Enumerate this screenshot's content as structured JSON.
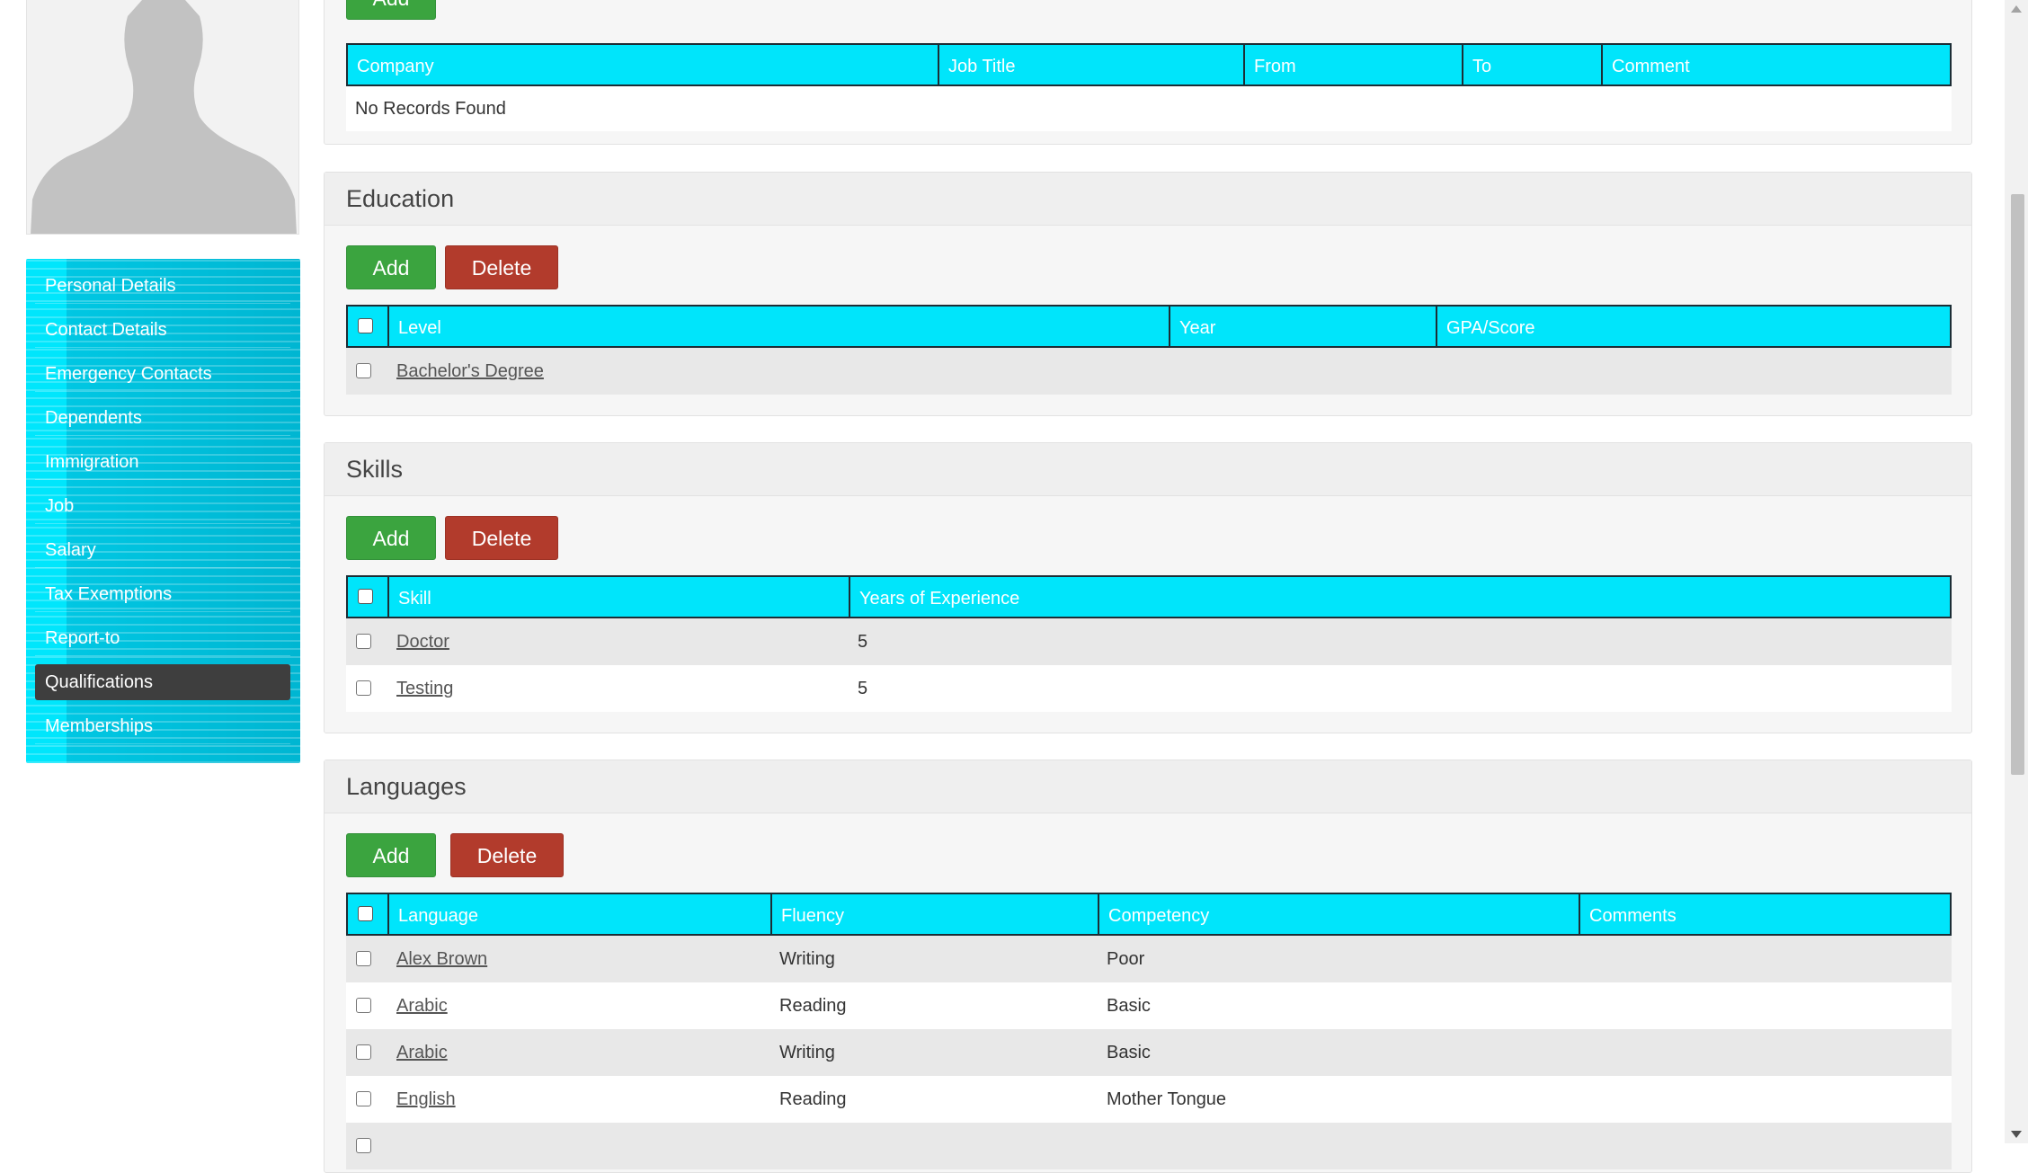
{
  "sidebar": {
    "items": [
      {
        "label": "Personal Details"
      },
      {
        "label": "Contact Details"
      },
      {
        "label": "Emergency Contacts"
      },
      {
        "label": "Dependents"
      },
      {
        "label": "Immigration"
      },
      {
        "label": "Job"
      },
      {
        "label": "Salary"
      },
      {
        "label": "Tax Exemptions"
      },
      {
        "label": "Report-to"
      },
      {
        "label": "Qualifications"
      },
      {
        "label": "Memberships"
      }
    ],
    "active": "Qualifications"
  },
  "work_experience": {
    "add_label": "Add",
    "columns": [
      "Company",
      "Job Title",
      "From",
      "To",
      "Comment"
    ],
    "empty_text": "No Records Found"
  },
  "education": {
    "title": "Education",
    "add_label": "Add",
    "delete_label": "Delete",
    "columns": [
      "Level",
      "Year",
      "GPA/Score"
    ],
    "rows": [
      {
        "level": "Bachelor's Degree",
        "year": "",
        "score": ""
      }
    ]
  },
  "skills": {
    "title": "Skills",
    "add_label": "Add",
    "delete_label": "Delete",
    "columns": [
      "Skill",
      "Years of Experience"
    ],
    "rows": [
      {
        "skill": "Doctor",
        "years": "5"
      },
      {
        "skill": "Testing",
        "years": "5"
      }
    ]
  },
  "languages": {
    "title": "Languages",
    "add_label": "Add",
    "delete_label": "Delete",
    "columns": [
      "Language",
      "Fluency",
      "Competency",
      "Comments"
    ],
    "rows": [
      {
        "language": "Alex Brown",
        "fluency": "Writing",
        "competency": "Poor",
        "comments": ""
      },
      {
        "language": "Arabic",
        "fluency": "Reading",
        "competency": "Basic",
        "comments": ""
      },
      {
        "language": "Arabic",
        "fluency": "Writing",
        "competency": "Basic",
        "comments": ""
      },
      {
        "language": "English",
        "fluency": "Reading",
        "competency": "Mother Tongue",
        "comments": ""
      }
    ]
  },
  "colors": {
    "table_header": "#00e5fb",
    "sidebar": "#00d2ee",
    "add_button": "#3ba43f",
    "delete_button": "#b23b2c",
    "active_nav": "#3e3e3e"
  }
}
